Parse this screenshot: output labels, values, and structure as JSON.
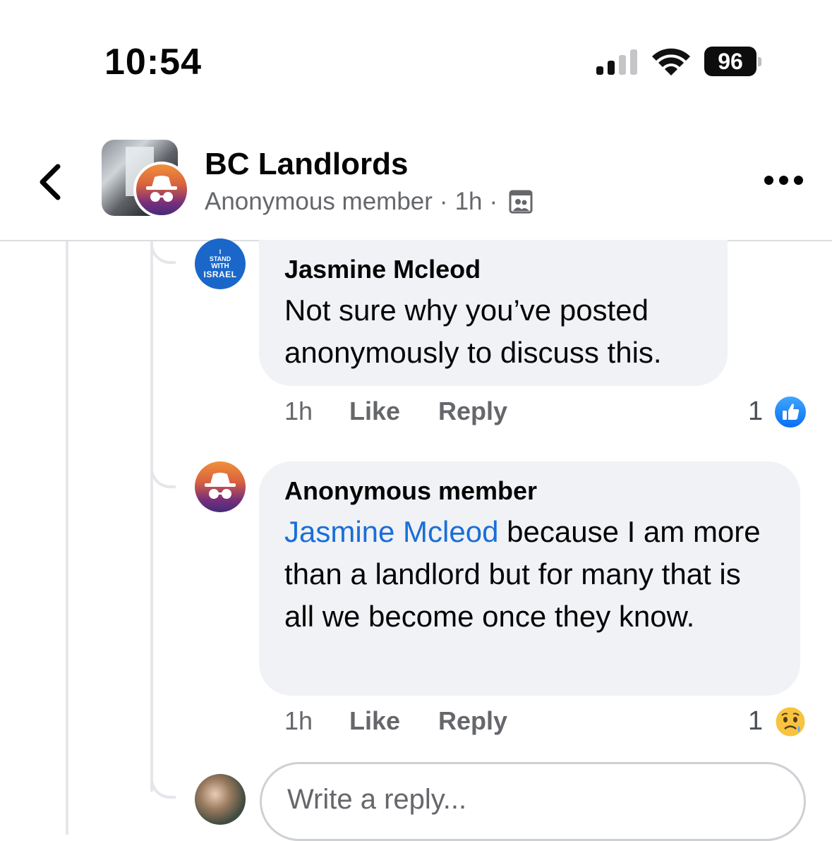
{
  "status_bar": {
    "time": "10:54",
    "battery": "96"
  },
  "header": {
    "group_name": "BC Landlords",
    "author": "Anonymous member",
    "dot": "·",
    "time": "1h"
  },
  "comments": [
    {
      "author": "Jasmine Mcleod",
      "avatar_text": [
        "I",
        "STAND",
        "WITH",
        "ISRAEL"
      ],
      "text": "Not sure why you’ve posted anonymously to discuss this.",
      "time": "1h",
      "like_label": "Like",
      "reply_label": "Reply",
      "reaction_count": "1",
      "reaction": "like-icon"
    },
    {
      "author": "Anonymous member",
      "mention": "Jasmine Mcleod",
      "text": " because I am more than a landlord but for many that is all we become once they know.",
      "time": "1h",
      "like_label": "Like",
      "reply_label": "Reply",
      "reaction_count": "1",
      "reaction": "sad-face-icon"
    }
  ],
  "reply_box": {
    "placeholder": "Write a reply..."
  },
  "colors": {
    "link_blue": "#1a6ed8",
    "bubble_bg": "#f0f2f5",
    "meta_gray": "#65676b"
  }
}
